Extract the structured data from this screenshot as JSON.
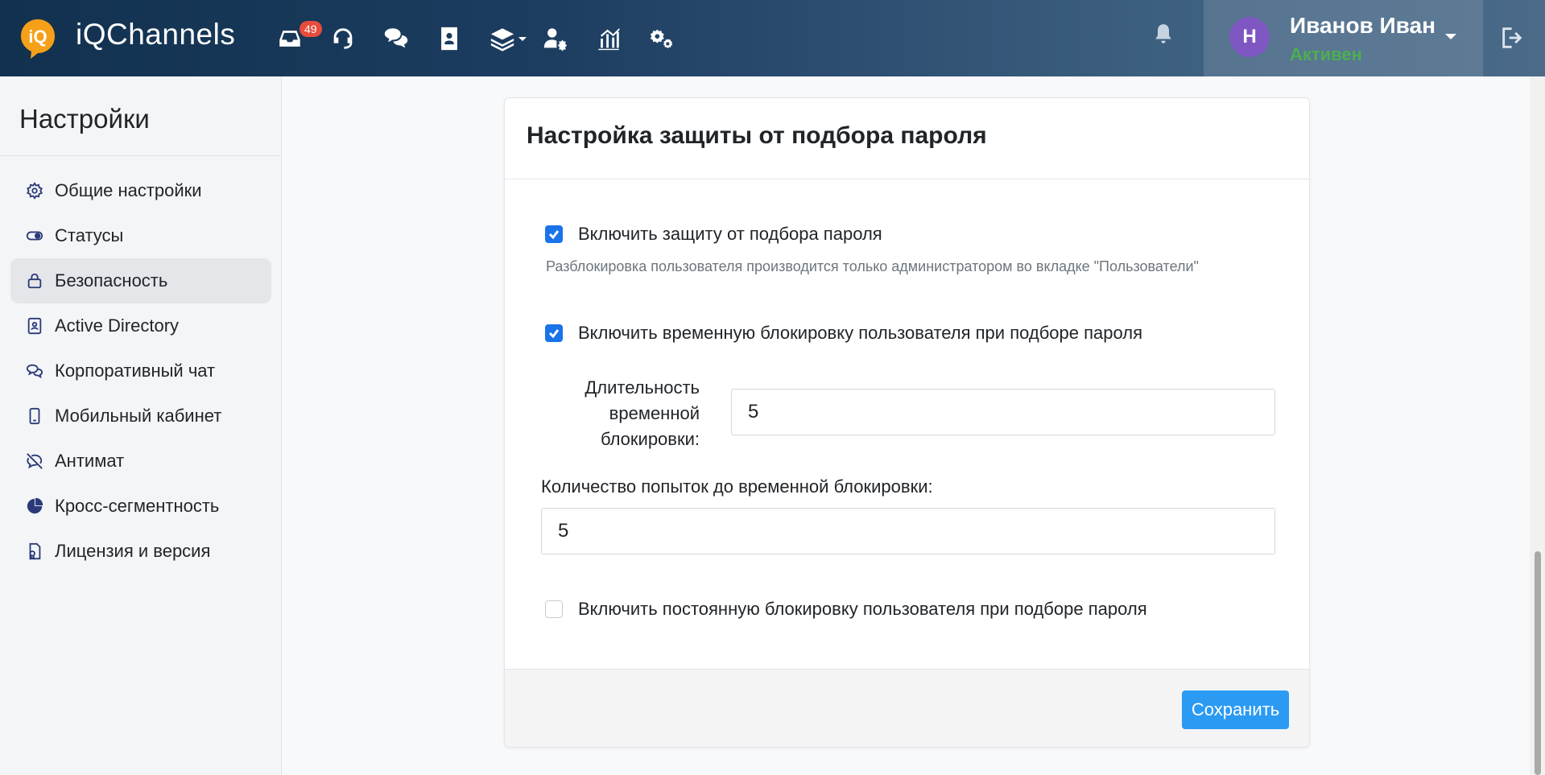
{
  "app": {
    "brand": "iQChannels",
    "colors": {
      "accent": "#2b9af3",
      "checkbox": "#1a73e8",
      "status": "#4caf50",
      "avatar": "#7e57c2",
      "badge": "#e74c3c"
    }
  },
  "topbar": {
    "nav": [
      {
        "name": "inbox-icon",
        "badge": "49"
      },
      {
        "name": "headset-icon"
      },
      {
        "name": "chat-icon"
      },
      {
        "name": "contacts-icon"
      },
      {
        "name": "layers-icon"
      },
      {
        "name": "users-gear-icon"
      },
      {
        "name": "analytics-icon"
      },
      {
        "name": "settings-icon"
      }
    ],
    "user": {
      "initial": "Н",
      "name": "Иванов Иван",
      "status": "Активен"
    }
  },
  "sidebar": {
    "title": "Настройки",
    "items": [
      {
        "label": "Общие настройки",
        "icon": "gear-icon"
      },
      {
        "label": "Статусы",
        "icon": "toggle-icon"
      },
      {
        "label": "Безопасность",
        "icon": "lock-icon",
        "active": true
      },
      {
        "label": "Active Directory",
        "icon": "id-card-icon"
      },
      {
        "label": "Корпоративный чат",
        "icon": "comments-icon"
      },
      {
        "label": "Мобильный кабинет",
        "icon": "mobile-icon"
      },
      {
        "label": "Антимат",
        "icon": "no-comment-icon"
      },
      {
        "label": "Кросс-сегментность",
        "icon": "pie-chart-icon"
      },
      {
        "label": "Лицензия и версия",
        "icon": "license-icon"
      }
    ]
  },
  "card": {
    "title": "Настройка защиты от подбора пароля",
    "protection": {
      "label": "Включить защиту от подбора пароля",
      "checked": true
    },
    "help": "Разблокировка пользователя производится только администратором во вкладке \"Пользователи\"",
    "temp_block": {
      "label": "Включить временную блокировку пользователя при подборе пароля",
      "checked": true
    },
    "duration": {
      "label": "Длительность временной блокировки:",
      "value": "5"
    },
    "attempts": {
      "label": "Количество попыток до временной блокировки:",
      "value": "5"
    },
    "perm_block": {
      "label": "Включить постоянную блокировку пользователя при подборе пароля",
      "checked": false
    },
    "save_label": "Сохранить"
  }
}
